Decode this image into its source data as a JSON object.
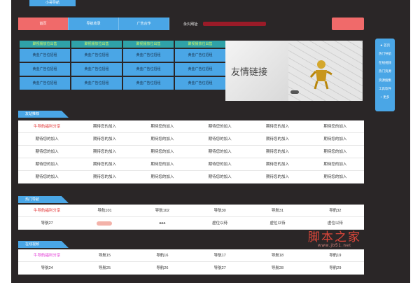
{
  "window": {
    "title": "小哥导航"
  },
  "topbar": {
    "buttons": [
      "首页",
      "导航收录",
      "广告合作"
    ],
    "url_label": "永久网址:"
  },
  "right_nav": [
    "★ 首页",
    "热门导航",
    "在线视频",
    "热门资源",
    "资源搜集",
    "工具软件",
    "+ 更多"
  ],
  "ads": {
    "top_row": [
      "聚视播放位出售",
      "聚视播放位出售",
      "聚视播放位出售",
      "聚视播放位出售"
    ],
    "gold": "黄金广告位招租",
    "gold_rows": 3
  },
  "banner": {
    "text": "友情链接"
  },
  "sections": {
    "links": {
      "title": "友站推荐"
    },
    "hot": {
      "title": "热门导航"
    },
    "online": {
      "title": "在线视频"
    }
  },
  "table1": [
    [
      "牛导航福利分享",
      "期待您的加入",
      "期待您的加入",
      "期待您的加入",
      "期待您的加入",
      "期待您的加入"
    ],
    [
      "期待您的加入",
      "期待您的加入",
      "期待您的加入",
      "期待您的加入",
      "期待您的加入",
      "期待您的加入"
    ],
    [
      "期待您的加入",
      "期待您的加入",
      "期待您的加入",
      "期待您的加入",
      "期待您的加入",
      "期待您的加入"
    ],
    [
      "期待您的加入",
      "期待您的加入",
      "期待您的加入",
      "期待您的加入",
      "期待您的加入",
      "期待您的加入"
    ],
    [
      "期待您的加入",
      "期待您的加入",
      "期待您的加入",
      "期待您的加入",
      "期待您的加入",
      "期待您的加入"
    ]
  ],
  "table2": [
    [
      "牛导航福利分享",
      "导航101",
      "导航102",
      "导航30",
      "导航31",
      "导航32"
    ],
    [
      "导航27",
      "",
      "aaa",
      "虚位以待",
      "虚位以待",
      "虚位以待"
    ]
  ],
  "table3": [
    [
      "牛导航福利分享",
      "导航15",
      "导航16",
      "导航17",
      "导航18",
      "导航19"
    ],
    [
      "导航24",
      "导航25",
      "导航26",
      "导航27",
      "导航28",
      "导航29"
    ]
  ],
  "watermark": {
    "big": "脚本之家",
    "small": "www.jb51.net"
  },
  "colors": {
    "accent": "#4aa6e6",
    "active": "#f06a6a",
    "hot": "#e23b3b",
    "background": "#2a2627"
  }
}
